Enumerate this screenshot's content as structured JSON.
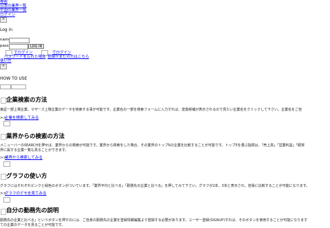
{
  "topnav": {
    "items": [
      "検索",
      "日本の業界一覧",
      "中国の業界一覧",
      "ログイン"
    ]
  },
  "close_glyph": "×",
  "login": {
    "title": "Log in",
    "name_label": "name",
    "pass_label": "pass",
    "button": "LOG IN",
    "social1": "でログイン",
    "social2": "でログイン",
    "forgot": "パスワードを忘れた場合",
    "register": "登録がまだの方はこちら",
    "howto_link": "使い方"
  },
  "howto": {
    "title": "HOW TO USE"
  },
  "sections": [
    {
      "heading": "企業検索の方法",
      "desc": "東証一部上場企業、マザーズ上場企業のデータを検索する事が可能です。企業名の一部を検索フォームに入力すれば、変換候補が表示されるので見たい企業名をクリックして下さい。企業名をご自",
      "link": "企業を検索してみる"
    },
    {
      "heading": "業界からの検索の方法",
      "desc": "メニューバーのSEARCHを押せば、業界からの検索が可能です。業界から検索をした場合、その業界のトップ6の企業を比較することが可能です。トップ5を選ぶ指標は、「売上高」「営業利益」「経常",
      "desc2": "界に属する企業一覧も見ることができます。",
      "link": "業界から検索してみる"
    },
    {
      "heading": "グラフの使い方",
      "desc": "グラフにはそれぞれピンクと緑色のボタンがついています。「業界平均と比べる」「勤務先の企業と比べる」を押してみて下さい。グラフが2本、3本と表示され、容易に比較することが可能になります。",
      "link": "グラフのデモを見てみる"
    },
    {
      "heading": "自分の勤務先の説明",
      "desc": "勤務先の企業と比べる」というボタンを押すのには、ご自身の勤務先の企業を登録情報編集より登録する必要があります。ユーザー登録(SIGNUP)すれば、そのボタンを使用することが可能になります",
      "desc2": "ての企業のデータを見ることが可能です。"
    }
  ]
}
